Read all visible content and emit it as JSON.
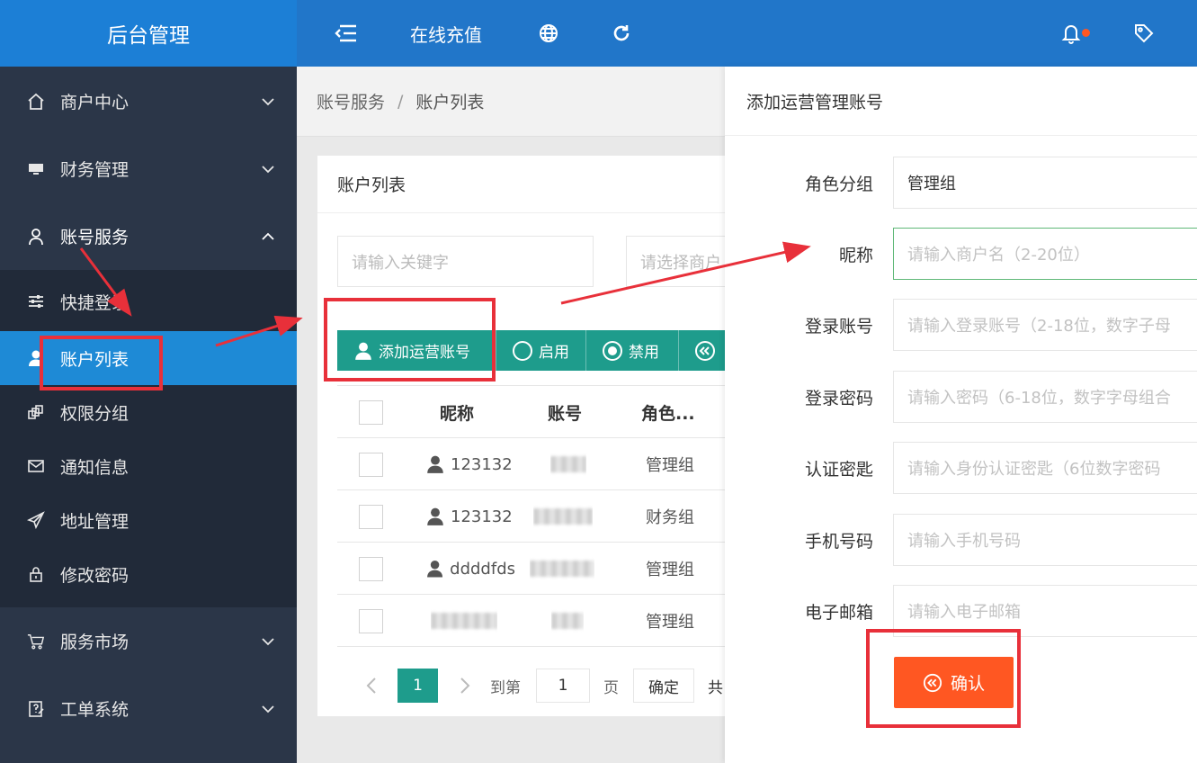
{
  "header": {
    "brand": "后台管理",
    "recharge": "在线充值",
    "icons": [
      "menu-fold-icon",
      "globe-icon",
      "refresh-icon",
      "bell-icon",
      "tag-icon"
    ]
  },
  "sidebar": {
    "items": [
      {
        "label": "商户中心",
        "icon": "home-icon"
      },
      {
        "label": "财务管理",
        "icon": "monitor-icon"
      },
      {
        "label": "账号服务",
        "icon": "user-icon"
      },
      {
        "label": "服务市场",
        "icon": "cart-icon"
      },
      {
        "label": "工单系统",
        "icon": "ticket-icon"
      }
    ],
    "subitems": [
      {
        "label": "快捷登录",
        "icon": "sliders-icon"
      },
      {
        "label": "账户列表",
        "icon": "user-solid-icon"
      },
      {
        "label": "权限分组",
        "icon": "layers-icon"
      },
      {
        "label": "通知信息",
        "icon": "mail-icon"
      },
      {
        "label": "地址管理",
        "icon": "send-icon"
      },
      {
        "label": "修改密码",
        "icon": "lock-icon"
      }
    ]
  },
  "breadcrumb": {
    "parent": "账号服务",
    "separator": "/",
    "current": "账户列表"
  },
  "card": {
    "title": "账户列表",
    "search_placeholder": "请输入关键字",
    "select_placeholder": "请选择商户",
    "buttons": {
      "add": "添加运营账号",
      "enable": "启用",
      "disable": "禁用"
    }
  },
  "table": {
    "headers": [
      "昵称",
      "账号",
      "角色..."
    ],
    "rows": [
      {
        "nickname": "123132",
        "role": "管理组"
      },
      {
        "nickname": "123132",
        "role": "财务组"
      },
      {
        "nickname": "ddddfds",
        "role": "管理组"
      },
      {
        "nickname": "",
        "role": "管理组"
      }
    ]
  },
  "pagination": {
    "page": "1",
    "goto_label": "到第",
    "goto_value": "1",
    "page_unit": "页",
    "confirm": "确定",
    "total_prefix": "共"
  },
  "panel": {
    "title": "添加运营管理账号",
    "fields": {
      "role_label": "角色分组",
      "role_value": "管理组",
      "nickname_label": "昵称",
      "nickname_placeholder": "请输入商户名（2-20位）",
      "login_label": "登录账号",
      "login_placeholder": "请输入登录账号（2-18位，数字子母",
      "password_label": "登录密码",
      "password_placeholder": "请输入密码（6-18位，数字字母组合",
      "auth_label": "认证密匙",
      "auth_placeholder": "请输入身份认证密匙（6位数字密码",
      "phone_label": "手机号码",
      "phone_placeholder": "请输入手机号码",
      "email_label": "电子邮箱",
      "email_placeholder": "请输入电子邮箱"
    },
    "confirm": "确认"
  },
  "colors": {
    "header": "#2176c9",
    "sidebar": "#2b3648",
    "active": "#1e8ad6",
    "teal": "#1e9c8c",
    "orange": "#ff5722",
    "annotation": "#e8303a"
  }
}
